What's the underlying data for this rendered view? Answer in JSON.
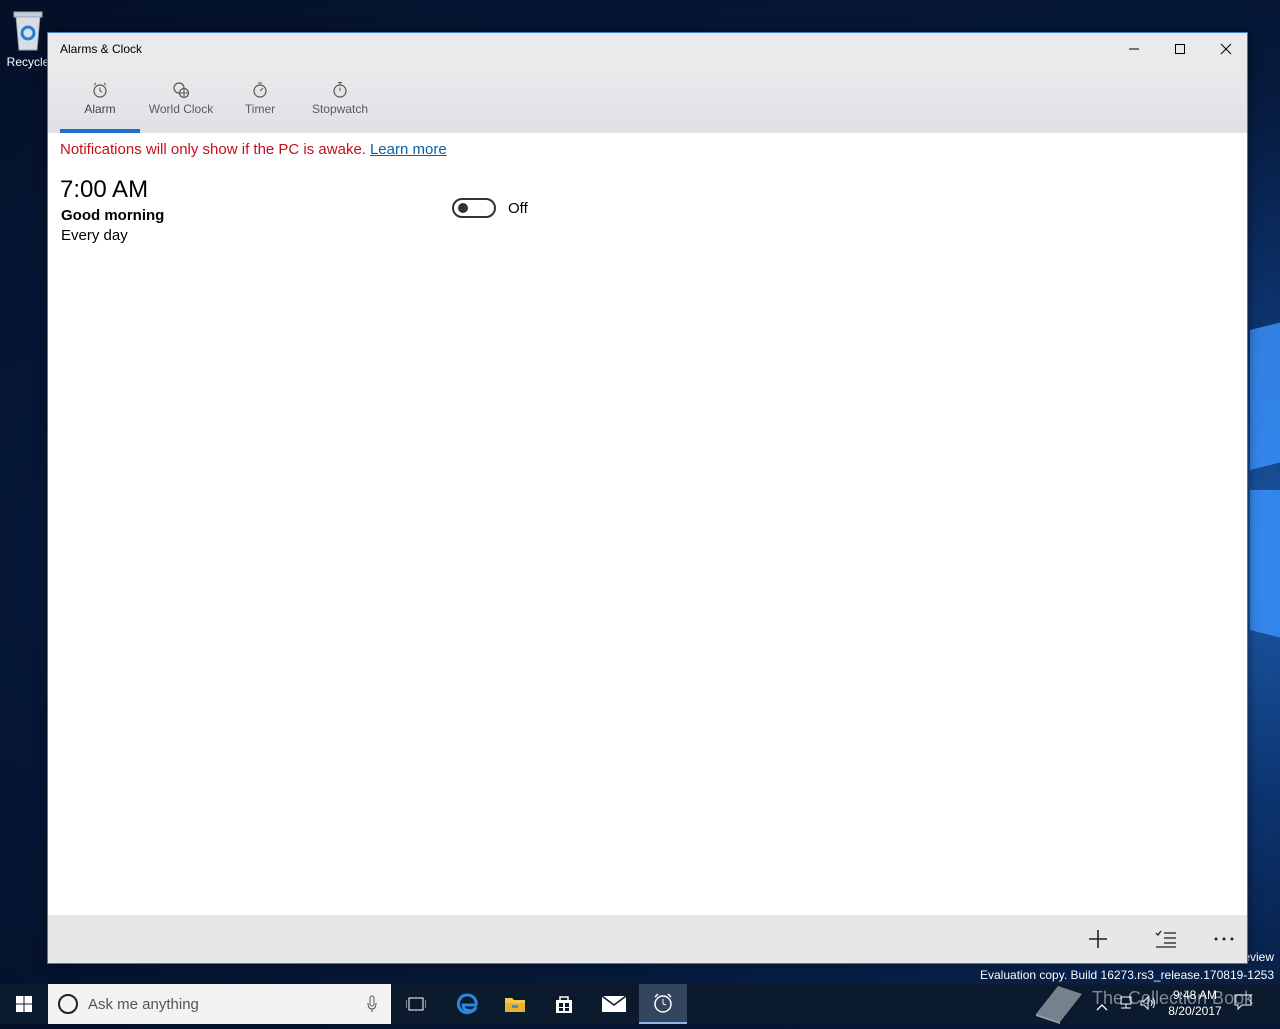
{
  "desktop": {
    "recycle_bin_label": "Recycle",
    "watermark_line1": "eview",
    "watermark_line2": "Evaluation copy. Build 16273.rs3_release.170819-1253",
    "collection_book": "The Collection Book"
  },
  "window": {
    "title": "Alarms & Clock",
    "tabs": [
      {
        "label": "Alarm",
        "icon": "alarm-icon",
        "active": true
      },
      {
        "label": "World Clock",
        "icon": "world-clock-icon",
        "active": false
      },
      {
        "label": "Timer",
        "icon": "timer-icon",
        "active": false
      },
      {
        "label": "Stopwatch",
        "icon": "stopwatch-icon",
        "active": false
      }
    ],
    "notice": {
      "text": "Notifications will only show if the PC is awake.",
      "link": "Learn more"
    },
    "alarm": {
      "time": "7:00 AM",
      "name": "Good morning",
      "repeat": "Every day",
      "toggle_state": "Off"
    },
    "commands": [
      "add-icon",
      "select-icon",
      "more-icon"
    ]
  },
  "taskbar": {
    "search_placeholder": "Ask me anything",
    "time": "9:48 AM",
    "date": "8/20/2017"
  },
  "colors": {
    "accent": "#1e6fc9",
    "notice_red": "#c50f1f",
    "link_blue": "#0063b1"
  }
}
